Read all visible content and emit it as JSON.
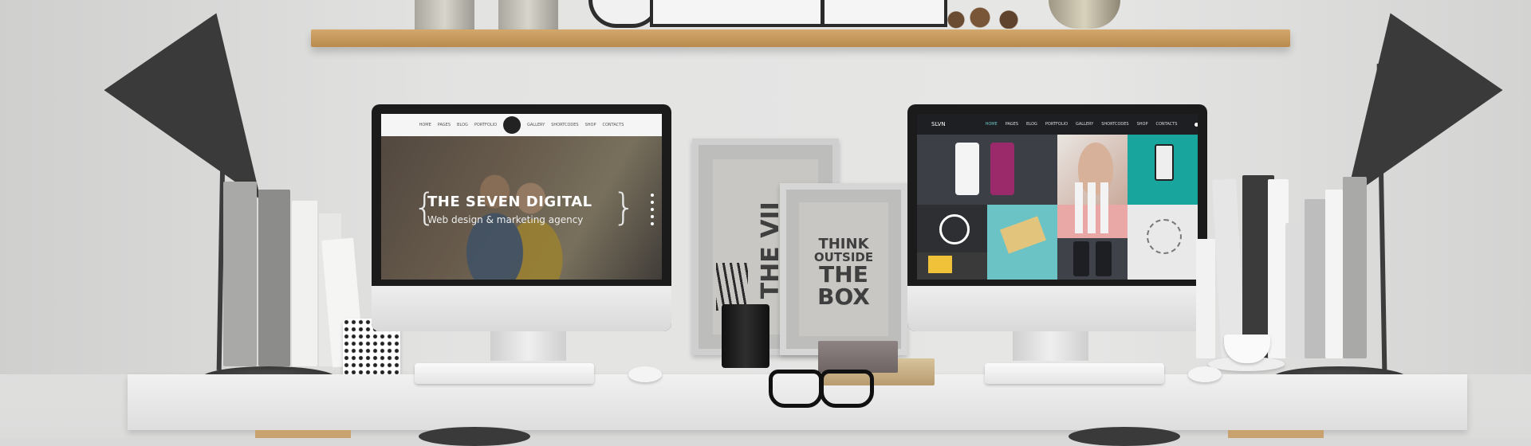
{
  "left_screen": {
    "nav_items": [
      "HOME",
      "PAGES",
      "BLOG",
      "PORTFOLIO",
      "GALLERY",
      "SHORTCODES",
      "SHOP",
      "CONTACTS"
    ],
    "hero_title": "THE SEVEN DIGITAL",
    "hero_subtitle": "Web design & marketing agency"
  },
  "right_screen": {
    "brand": "SLVN",
    "nav_items": [
      "HOME",
      "PAGES",
      "BLOG",
      "PORTFOLIO",
      "GALLERY",
      "SHORTCODES",
      "SHOP",
      "CONTACTS"
    ]
  },
  "posters": {
    "back": "THE VII",
    "front_lines": [
      "THINK",
      "OUTSIDE",
      "THE",
      "BOX"
    ]
  },
  "colors": {
    "wall": "#e1e1e0",
    "shelf_wood": "#c79b5e",
    "desk": "#ececec",
    "lamp": "#3a3a3a",
    "teal_tile": "#6cc3c6",
    "pink_tile": "#e9a8a6"
  }
}
